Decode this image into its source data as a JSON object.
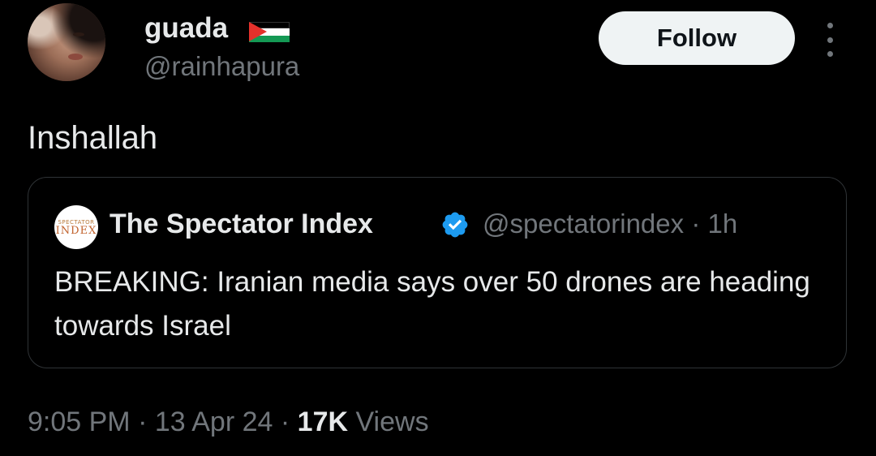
{
  "author": {
    "display_name": "guada",
    "handle": "@rainhapura",
    "flag_icon": "palestine-flag-emoji"
  },
  "actions": {
    "follow_label": "Follow",
    "more_icon": "more-vertical-icon"
  },
  "tweet": {
    "text": "Inshallah"
  },
  "quoted_tweet": {
    "avatar_text_small": "SPECTATOR",
    "avatar_text_big": "INDEX",
    "display_name": "The Spectator Index",
    "verified_icon": "verified-badge-icon",
    "handle": "@spectatorindex",
    "separator": "·",
    "time_ago": "1h",
    "text": "BREAKING: Iranian media says over 50 drones are heading towards Israel"
  },
  "footer": {
    "time": "9:05 PM",
    "separator": "·",
    "date": "13 Apr 24",
    "views_count": "17K",
    "views_label": "Views"
  },
  "colors": {
    "background": "#000000",
    "primary_text": "#e7e9ea",
    "secondary_text": "#71767b",
    "verified_blue": "#1d9bf0",
    "border": "#2f3336"
  }
}
